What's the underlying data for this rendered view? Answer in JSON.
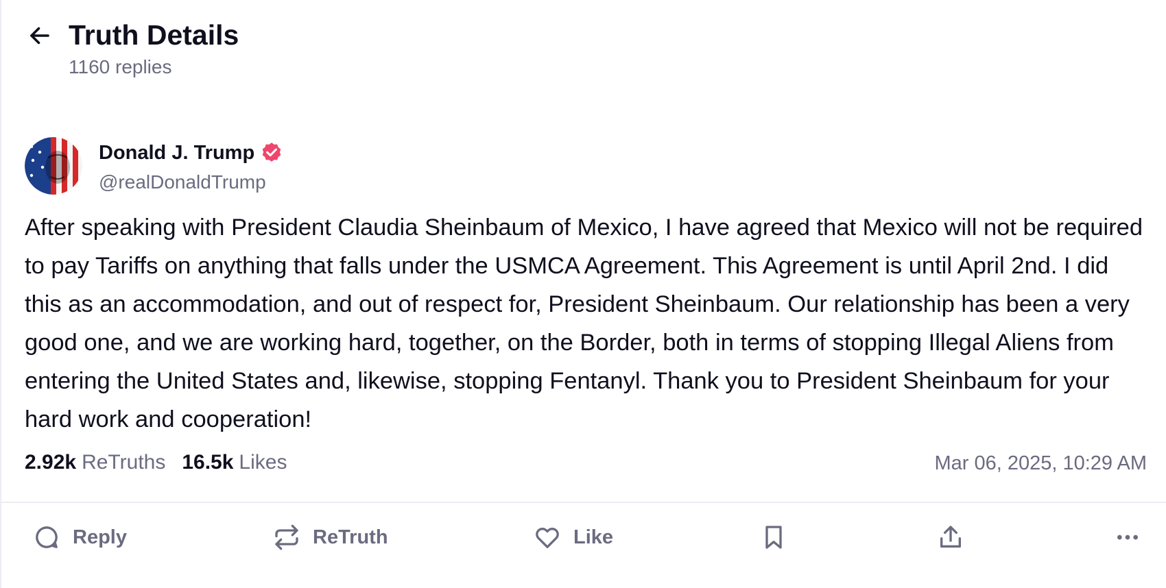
{
  "header": {
    "title": "Truth Details",
    "replies": "1160 replies"
  },
  "author": {
    "name": "Donald J. Trump",
    "handle": "@realDonaldTrump",
    "verified": true
  },
  "post": {
    "text": "After speaking with President Claudia Sheinbaum of Mexico, I have agreed that Mexico will not be required to pay Tariffs on anything that falls under the USMCA Agreement. This Agreement is until April 2nd. I did this as an accommodation, and out of respect for, President Sheinbaum. Our relationship has been a very good one, and we are working hard, together, on the Border, both in terms of stopping Illegal Aliens from entering the United States and, likewise, stopping Fentanyl. Thank you to President Sheinbaum for your hard work and cooperation!",
    "retruths_count": "2.92k",
    "retruths_label": "ReTruths",
    "likes_count": "16.5k",
    "likes_label": "Likes",
    "timestamp": "Mar 06, 2025, 10:29 AM"
  },
  "actions": {
    "reply_label": "Reply",
    "retruth_label": "ReTruth",
    "like_label": "Like"
  },
  "icons": {
    "back": "arrow-left-icon",
    "verified": "verified-badge-icon",
    "reply": "speech-bubble-icon",
    "retruth": "repost-arrows-icon",
    "like": "heart-icon",
    "bookmark": "bookmark-icon",
    "share": "share-upload-icon",
    "more": "ellipsis-icon"
  },
  "colors": {
    "text": "#0f0f1e",
    "muted": "#6b6b80",
    "verified": "#f0466e",
    "divider": "#ececf2"
  }
}
